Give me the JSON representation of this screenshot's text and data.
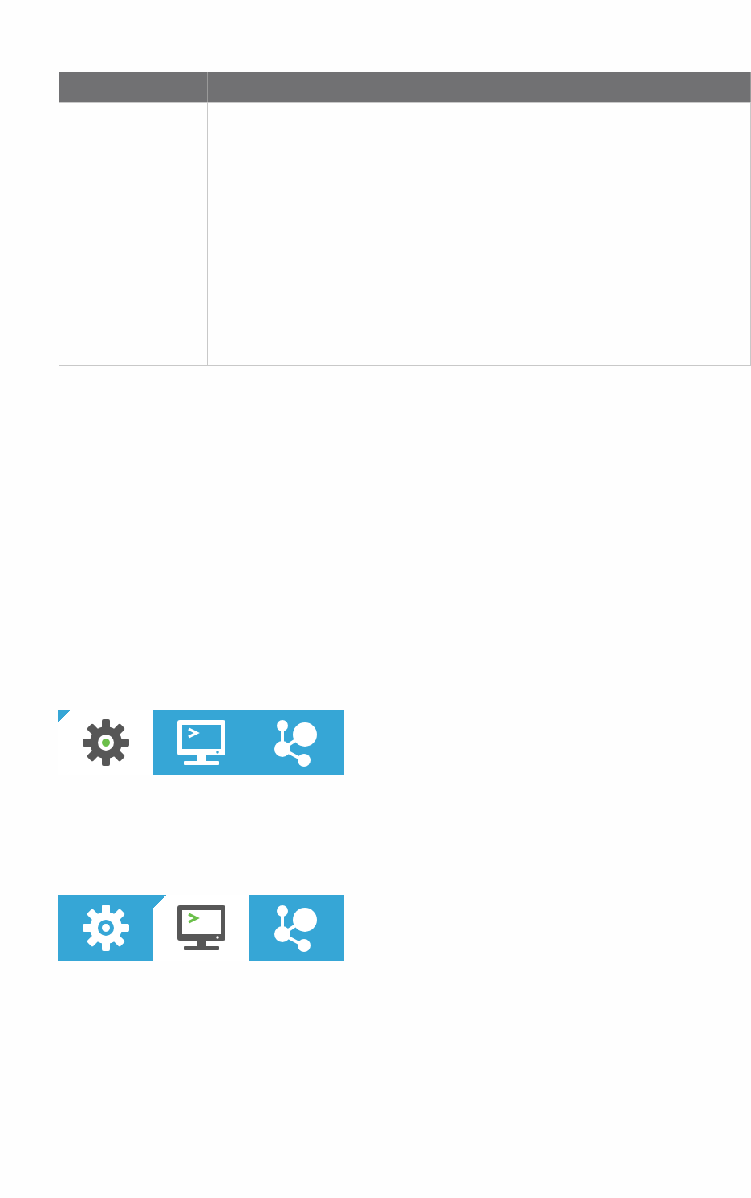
{
  "table": {
    "columns": [
      {
        "kind": "narrow"
      },
      {
        "kind": "wide"
      }
    ],
    "rows": [
      {
        "kind": "short"
      },
      {
        "kind": "medium"
      },
      {
        "kind": "tall"
      }
    ]
  },
  "tab_bars": [
    {
      "tabs": [
        {
          "kind": "gear",
          "selected": true
        },
        {
          "kind": "monitor",
          "selected": false
        },
        {
          "kind": "share",
          "selected": false
        }
      ]
    },
    {
      "tabs": [
        {
          "kind": "gear",
          "selected": false
        },
        {
          "kind": "monitor",
          "selected": true
        },
        {
          "kind": "share",
          "selected": false
        }
      ]
    }
  ]
}
